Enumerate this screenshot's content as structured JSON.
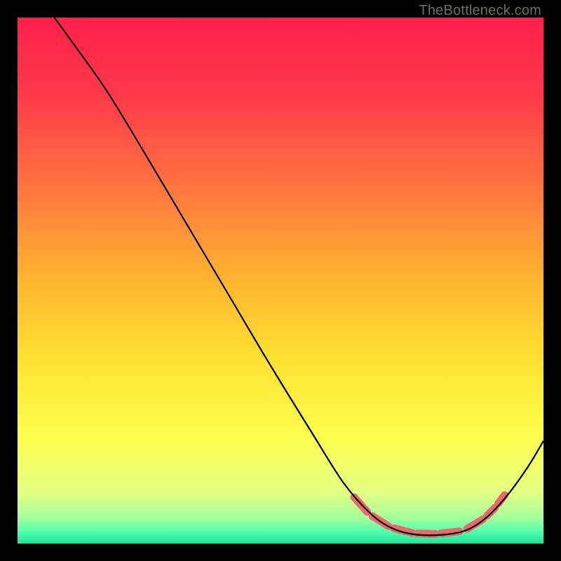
{
  "attribution": "TheBottleneck.com",
  "chart_data": {
    "type": "line",
    "title": "",
    "xlabel": "",
    "ylabel": "",
    "xlim": [
      0,
      100
    ],
    "ylim": [
      0,
      100
    ],
    "grid": false,
    "legend": false,
    "gradient_stops": [
      {
        "offset": 0.0,
        "color": "#ff1f4a"
      },
      {
        "offset": 0.15,
        "color": "#ff3a49"
      },
      {
        "offset": 0.32,
        "color": "#ff7440"
      },
      {
        "offset": 0.5,
        "color": "#ffb52f"
      },
      {
        "offset": 0.66,
        "color": "#ffe333"
      },
      {
        "offset": 0.8,
        "color": "#fdff4f"
      },
      {
        "offset": 0.9,
        "color": "#e6ff82"
      },
      {
        "offset": 0.95,
        "color": "#a7ff9a"
      },
      {
        "offset": 0.975,
        "color": "#5dffad"
      },
      {
        "offset": 1.0,
        "color": "#17e89a"
      }
    ],
    "series": [
      {
        "name": "bottleneck-curve",
        "color": "#000000",
        "points": [
          {
            "x": 7.0,
            "y": 100.0
          },
          {
            "x": 11.0,
            "y": 94.5
          },
          {
            "x": 17.0,
            "y": 86.0
          },
          {
            "x": 24.0,
            "y": 74.5
          },
          {
            "x": 32.0,
            "y": 61.0
          },
          {
            "x": 40.0,
            "y": 47.5
          },
          {
            "x": 48.0,
            "y": 34.0
          },
          {
            "x": 56.0,
            "y": 21.0
          },
          {
            "x": 62.0,
            "y": 11.5
          },
          {
            "x": 67.0,
            "y": 5.8
          },
          {
            "x": 71.0,
            "y": 3.0
          },
          {
            "x": 75.0,
            "y": 1.8
          },
          {
            "x": 80.0,
            "y": 1.6
          },
          {
            "x": 85.0,
            "y": 2.4
          },
          {
            "x": 89.0,
            "y": 4.8
          },
          {
            "x": 93.0,
            "y": 9.0
          },
          {
            "x": 97.0,
            "y": 14.5
          },
          {
            "x": 100.0,
            "y": 19.5
          }
        ]
      }
    ],
    "markers": {
      "name": "highlight-pills",
      "color": "#e86a6a",
      "segments": [
        {
          "x1": 64.0,
          "y1": 8.8,
          "x2": 66.5,
          "y2": 6.0
        },
        {
          "x1": 67.5,
          "y1": 5.2,
          "x2": 70.5,
          "y2": 3.3
        },
        {
          "x1": 71.5,
          "y1": 2.9,
          "x2": 75.0,
          "y2": 2.0
        },
        {
          "x1": 76.0,
          "y1": 1.9,
          "x2": 79.5,
          "y2": 1.8
        },
        {
          "x1": 80.5,
          "y1": 1.9,
          "x2": 84.0,
          "y2": 2.3
        },
        {
          "x1": 85.5,
          "y1": 2.8,
          "x2": 88.5,
          "y2": 4.6
        },
        {
          "x1": 89.3,
          "y1": 5.3,
          "x2": 90.8,
          "y2": 6.8
        },
        {
          "x1": 91.4,
          "y1": 7.6,
          "x2": 92.6,
          "y2": 9.2
        }
      ]
    }
  }
}
